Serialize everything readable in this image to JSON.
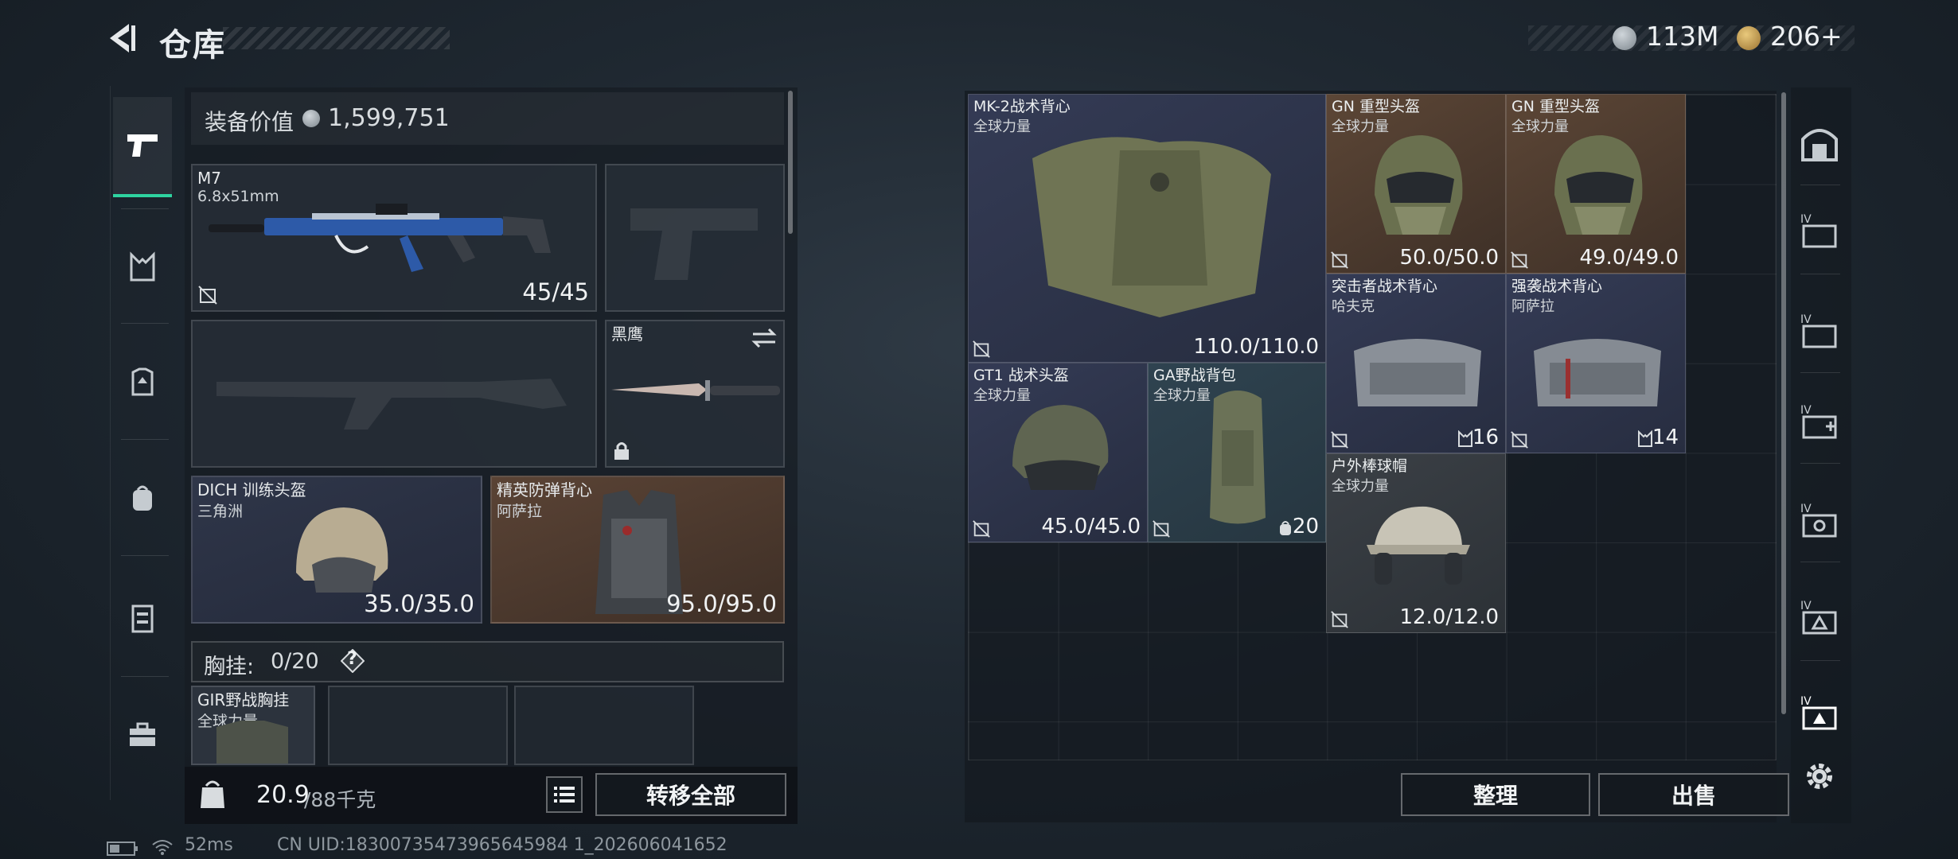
{
  "header": {
    "title": "仓库",
    "currency_1": "113M",
    "currency_2": "206+"
  },
  "left_sidebar": {
    "items": [
      {
        "name": "weapons",
        "icon": "pistol-icon",
        "active": true
      },
      {
        "name": "vests",
        "icon": "chest-rig-icon",
        "active": false
      },
      {
        "name": "armor",
        "icon": "armor-icon",
        "active": false
      },
      {
        "name": "backpacks",
        "icon": "backpack-icon",
        "active": false
      },
      {
        "name": "keys",
        "icon": "locker-icon",
        "active": false
      },
      {
        "name": "cases",
        "icon": "briefcase-icon",
        "active": false
      }
    ]
  },
  "equipment": {
    "value_label": "装备价值",
    "value": "1,599,751",
    "primary_weapon": {
      "name": "M7",
      "caliber": "6.8x51mm",
      "ammo": "45/45"
    },
    "melee": {
      "name": "黑鹰"
    },
    "helmet": {
      "name": "DICH 训练头盔",
      "origin": "三角洲",
      "durability": "35.0/35.0"
    },
    "armor": {
      "name": "精英防弹背心",
      "origin": "阿萨拉",
      "durability": "95.0/95.0"
    },
    "chest_rig_label": "胸挂:",
    "chest_rig_capacity": "0/20",
    "chest_rig_help": "?",
    "chest_rig_item": {
      "name": "GIR野战胸挂",
      "origin": "全球力量"
    },
    "weight": "20.9",
    "weight_max": "/88千克",
    "transfer_all": "转移全部"
  },
  "storage": {
    "items": [
      {
        "name": "MK-2战术背心",
        "origin": "全球力量",
        "value": "110.0/110.0"
      },
      {
        "name": "GN 重型头盔",
        "origin": "全球力量",
        "value": "50.0/50.0"
      },
      {
        "name": "GN 重型头盔",
        "origin": "全球力量",
        "value": "49.0/49.0"
      },
      {
        "name": "突击者战术背心",
        "origin": "哈夫克",
        "value": "16"
      },
      {
        "name": "强袭战术背心",
        "origin": "阿萨拉",
        "value": "14"
      },
      {
        "name": "GT1 战术头盔",
        "origin": "全球力量",
        "value": "45.0/45.0"
      },
      {
        "name": "GA野战背包",
        "origin": "全球力量",
        "value": "20"
      },
      {
        "name": "户外棒球帽",
        "origin": "全球力量",
        "value": "12.0/12.0"
      }
    ],
    "sort_button": "整理",
    "sell_button": "出售"
  },
  "right_sidebar": {
    "items": [
      {
        "icon": "stash-main-icon"
      },
      {
        "icon": "stash-tab-1-icon",
        "level": "IV"
      },
      {
        "icon": "stash-tab-2-icon",
        "level": "IV"
      },
      {
        "icon": "stash-tab-3-icon",
        "level": "IV"
      },
      {
        "icon": "stash-tab-4-icon",
        "level": "IV"
      },
      {
        "icon": "stash-tab-5-icon",
        "level": "IV"
      },
      {
        "icon": "stash-tab-6-icon",
        "level": "IV"
      },
      {
        "icon": "settings-icon"
      }
    ]
  },
  "status_bar": {
    "ping": "52ms",
    "uid": "CN UID:18300735473965645984 1_202606041652"
  },
  "colors": {
    "accent": "#2ed3a0",
    "blue_rarity": "#303750",
    "brown_rarity": "#574233",
    "teal_rarity": "#2f4350"
  }
}
